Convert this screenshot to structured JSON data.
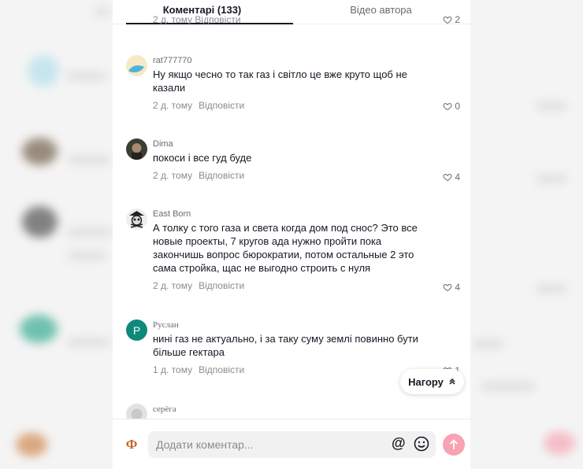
{
  "tabs": [
    {
      "label": "Коментарі (133)",
      "active": true
    },
    {
      "label": "Відео автора",
      "active": false
    }
  ],
  "partial_top": {
    "meta": "2 д. тому   Відповісти",
    "likes": "2"
  },
  "comments": [
    {
      "author": "rat777770",
      "text": "Ну якщо чесно то так газ і світло це вже круто щоб не казали",
      "time": "2 д. тому",
      "reply": "Відповісти",
      "likes": "0"
    },
    {
      "author": "Dima",
      "text": "покоси і все гуд буде",
      "time": "2 д. тому",
      "reply": "Відповісти",
      "likes": "4"
    },
    {
      "author": "East Born",
      "text": "А толку с того газа и света когда дом под снос? Это все новые проекты, 7 кругов ада нужно пройти пока закончишь вопрос бюрократии, потом остальные 2 это сама стройка, щас не выгодно строить с нуля",
      "time": "2 д. тому",
      "reply": "Відповісти",
      "likes": "4"
    },
    {
      "author": "Руслан",
      "avatar_letter": "Р",
      "text": "нині газ не актуально, і за таку суму землі повинно бути більше гектара",
      "time": "1 д. тому",
      "reply": "Відповісти",
      "likes": "1"
    },
    {
      "author": "серёга"
    }
  ],
  "back_to_top": "Нагору",
  "composer": {
    "placeholder": "Додати коментар...",
    "me_letter": "Ф"
  },
  "colors": {
    "accent_send": "#f7a3b3",
    "ruslan_avatar": "#0d8a7a"
  }
}
